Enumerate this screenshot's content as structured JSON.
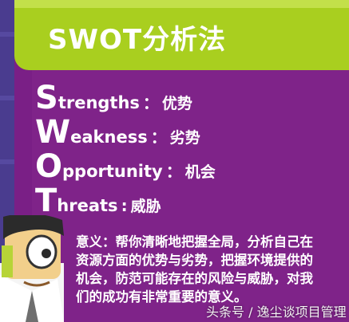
{
  "title": "SWOT分析法",
  "items": [
    {
      "letter": "S",
      "rest": "trengths",
      "sep": "：",
      "cn": "优势"
    },
    {
      "letter": "W",
      "rest": "eakness",
      "sep": "：",
      "cn": "劣势"
    },
    {
      "letter": "O",
      "rest": "pportunity",
      "sep": "：",
      "cn": "机会"
    },
    {
      "letter": "T",
      "rest": "hreats",
      "sep": ":",
      "cn": "威胁"
    }
  ],
  "description": {
    "label": "意义：",
    "text": "帮你清晰地把握全局，分析自己在资源方面的优势与劣势，把握环境提供的机会，防范可能存在的风险与威胁，对我们的成功有非常重要的意义。"
  },
  "watermark": "头条号 / 逸尘谈项目管理",
  "colors": {
    "background": "#4a3c8f",
    "card": "#7a1f86",
    "banner": "#a9cf1f",
    "text": "#ffffff"
  }
}
